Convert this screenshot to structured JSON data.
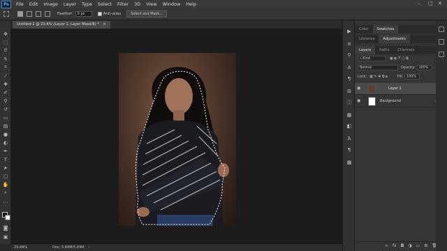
{
  "menubar": {
    "logo": "Ps",
    "items": [
      "File",
      "Edit",
      "Image",
      "Layer",
      "Type",
      "Select",
      "Filter",
      "3D",
      "View",
      "Window",
      "Help"
    ],
    "controls": [
      "–",
      "□",
      "✕"
    ]
  },
  "options": {
    "feather_label": "Feather:",
    "feather_value": "0 px",
    "antialias_label": "Anti-alias",
    "select_mask_label": "Select and Mask..."
  },
  "document": {
    "tab_title": "Untitled-1 @ 23.4% (Layer 1, Layer Mask/8) *",
    "zoom": "23.44%",
    "doc_info": "Doc: 5.84M/5.84M"
  },
  "panels": {
    "top_tabs": [
      "Color",
      "Swatches"
    ],
    "second_tabs": [
      "Libraries",
      "Adjustments"
    ],
    "layer_tabs": [
      "Layers",
      "Paths",
      "Channels"
    ],
    "kind_label": "Kind",
    "blend_mode": "Normal",
    "opacity_label": "Opacity:",
    "opacity_value": "100%",
    "lock_label": "Lock:",
    "fill_label": "Fill:",
    "fill_value": "100%",
    "layers": [
      {
        "name": "Layer 1"
      },
      {
        "name": "Background"
      }
    ]
  },
  "colors": {
    "accent": "#3b8fd6",
    "background": "#282828"
  }
}
